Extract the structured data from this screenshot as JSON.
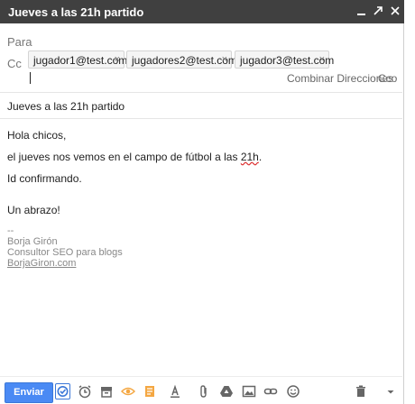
{
  "window": {
    "title": "Jueves a las 21h partido"
  },
  "header": {
    "para_label": "Para",
    "cc_label": "Cc",
    "cc_recipients": [
      "jugador1@test.com",
      "jugadores2@test.com",
      "jugador3@test.com"
    ],
    "chip_remove_glyph": "×",
    "combinar_label": "Combinar Direcciones",
    "cco_label": "Cco"
  },
  "subject": "Jueves a las 21h partido",
  "message": {
    "greeting": "Hola chicos,",
    "line1_prefix": "el jueves nos vemos en el campo de fútbol a las ",
    "line1_flagged": "21h",
    "line1_suffix": ".",
    "line2": "Id confirmando.",
    "closing": "Un abrazo!",
    "sig_sep": "--",
    "sig_name": "Borja Girón",
    "sig_title": "Consultor SEO para blogs",
    "sig_link": "BorjaGiron.com"
  },
  "toolbar": {
    "send_label": "Enviar",
    "icons": [
      "schedule-send-icon",
      "alarm-icon",
      "archive-icon",
      "eye-icon",
      "note-icon",
      "text-format-icon",
      "attach-icon",
      "drive-icon",
      "image-icon",
      "link-icon",
      "emoji-icon",
      "trash-icon",
      "more-options-icon"
    ]
  },
  "colors": {
    "titlebar": "#404040",
    "send_button": "#4a8af4",
    "accent_orange": "#f4a742"
  }
}
